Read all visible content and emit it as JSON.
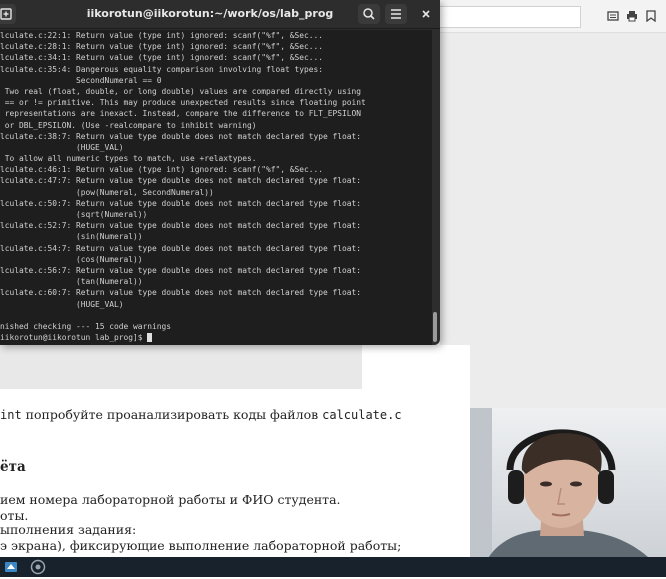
{
  "terminal": {
    "title": "iikorotun@iikorotun:~/work/os/lab_prog",
    "lines": [
      "lculate.c:22:1: Return value (type int) ignored: scanf(\"%f\", &Sec...",
      "lculate.c:28:1: Return value (type int) ignored: scanf(\"%f\", &Sec...",
      "lculate.c:34:1: Return value (type int) ignored: scanf(\"%f\", &Sec...",
      "lculate.c:35:4: Dangerous equality comparison involving float types:",
      "                SecondNumeral == 0",
      " Two real (float, double, or long double) values are compared directly using",
      " == or != primitive. This may produce unexpected results since floating point",
      " representations are inexact. Instead, compare the difference to FLT_EPSILON",
      " or DBL_EPSILON. (Use -realcompare to inhibit warning)",
      "lculate.c:38:7: Return value type double does not match declared type float:",
      "                (HUGE_VAL)",
      " To allow all numeric types to match, use +relaxtypes.",
      "lculate.c:46:1: Return value (type int) ignored: scanf(\"%f\", &Sec...",
      "lculate.c:47:7: Return value type double does not match declared type float:",
      "                (pow(Numeral, SecondNumeral))",
      "lculate.c:50:7: Return value type double does not match declared type float:",
      "                (sqrt(Numeral))",
      "lculate.c:52:7: Return value type double does not match declared type float:",
      "                (sin(Numeral))",
      "lculate.c:54:7: Return value type double does not match declared type float:",
      "                (cos(Numeral))",
      "lculate.c:56:7: Return value type double does not match declared type float:",
      "                (tan(Numeral))",
      "lculate.c:60:7: Return value type double does not match declared type float:",
      "                (HUGE_VAL)",
      "",
      "nished checking --- 15 code warnings"
    ],
    "prompt": "iikorotun@iikorotun lab_prog]$ ",
    "icons": {
      "new_tab": "new-tab-icon",
      "search": "search-icon",
      "menu": "hamburger-menu-icon",
      "close": "close-icon"
    }
  },
  "document": {
    "line1_prefix": "int",
    "line1_text": " попробуйте проанализировать коды файлов ",
    "line1_code": "calculate.c",
    "heading": "ёта",
    "p1": "ием номера лабораторной работы и ФИО студента.",
    "p2": "оты.",
    "p3": "ыполнения задания:",
    "p4": "э экрана), фиксирующие выполнение лабораторной работы;"
  },
  "browser": {
    "icons": [
      "reader-mode-icon",
      "print-icon",
      "bookmark-icon"
    ]
  },
  "taskbar": {
    "icons": [
      "app-launcher-icon",
      "chrome-icon"
    ]
  },
  "colors": {
    "terminal_bg": "#1e1e1e",
    "terminal_header": "#2d2d2d",
    "terminal_text": "#d0d0d0",
    "taskbar": "#17222c"
  }
}
